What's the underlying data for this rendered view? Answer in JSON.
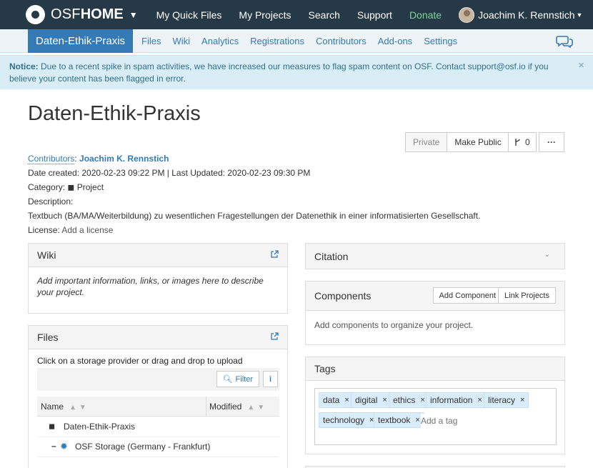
{
  "topnav": {
    "brand_light": "OSF",
    "brand_bold": "HOME",
    "links": [
      "My Quick Files",
      "My Projects",
      "Search",
      "Support",
      "Donate"
    ],
    "user_name": "Joachim K. Rennstich"
  },
  "projnav": {
    "title": "Daten-Ethik-Praxis",
    "links": [
      "Files",
      "Wiki",
      "Analytics",
      "Registrations",
      "Contributors",
      "Add-ons",
      "Settings"
    ]
  },
  "notice": {
    "label": "Notice:",
    "text": "Due to a recent spike in spam activities, we have increased our measures to flag spam content on OSF. Contact support@osf.io if you believe your content has been flagged in error.",
    "close": "×"
  },
  "project": {
    "title": "Daten-Ethik-Praxis",
    "privacy": "Private",
    "make_public": "Make Public",
    "fork_count": "0",
    "more": "···",
    "contributors_label": "Contributors",
    "contributor": "Joachim K. Rennstich",
    "dates": "Date created: 2020-02-23 09:22 PM | Last Updated: 2020-02-23 09:30 PM",
    "category_label": "Category:",
    "category": "Project",
    "description_label": "Description:",
    "description": "Textbuch (BA/MA/Weiterbildung) zu wesentlichen Fragestellungen der Datenethik in einer informatisierten Gesellschaft.",
    "license_label": "License:",
    "license_link": "Add a license"
  },
  "wiki": {
    "title": "Wiki",
    "text": "Add important information, links, or images here to describe your project."
  },
  "files": {
    "title": "Files",
    "instruction": "Click on a storage provider or drag and drop to upload",
    "filter": "Filter",
    "info": "i",
    "col_name": "Name",
    "col_modified": "Modified",
    "rows": [
      {
        "name": "Daten-Ethik-Praxis"
      },
      {
        "name": "OSF Storage (Germany - Frankfurt)"
      }
    ]
  },
  "citation": {
    "title": "Citation"
  },
  "components": {
    "title": "Components",
    "add_button": "Add Component",
    "link_button": "Link Projects",
    "text": "Add components to organize your project."
  },
  "tags": {
    "title": "Tags",
    "items": [
      "data",
      "digital",
      "ethics",
      "information",
      "literacy",
      "technology",
      "textbook"
    ],
    "placeholder": "Add a tag"
  },
  "colors": {
    "nav": "#263947",
    "accent": "#337ab7",
    "donate": "#7fd29a",
    "notice_bg": "#d9edf7"
  }
}
